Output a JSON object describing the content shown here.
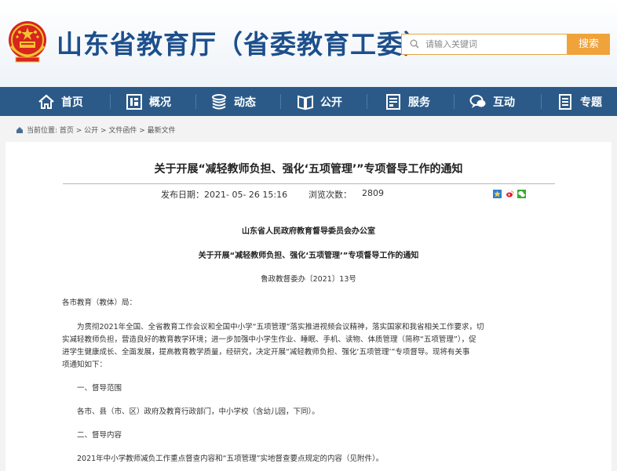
{
  "header": {
    "site_title": "山东省教育厅（省委教育工委）",
    "search_placeholder": "请输入关键词",
    "search_button": "搜索"
  },
  "nav": [
    {
      "label": "首页",
      "icon": "home-icon"
    },
    {
      "label": "概况",
      "icon": "overview-icon"
    },
    {
      "label": "动态",
      "icon": "news-stack-icon"
    },
    {
      "label": "公开",
      "icon": "book-icon"
    },
    {
      "label": "服务",
      "icon": "service-doc-icon"
    },
    {
      "label": "互动",
      "icon": "chat-icon"
    },
    {
      "label": "专题",
      "icon": "topic-doc-icon"
    }
  ],
  "breadcrumb": {
    "text": "当前位置: 首页 > 公开 > 文件函件 > 最新文件"
  },
  "article": {
    "title": "关于开展“减轻教师负担、强化‘五项管理’”专项督导工作的通知",
    "published_label": "发布日期：",
    "published_value": "2021- 05- 26 15:16",
    "views_label": "浏览次数：",
    "views_value": "2809",
    "issuer": "山东省人民政府教育督导委员会办公室",
    "inner_title": "关于开展“减轻教师负担、强化‘五项管理’”专项督导工作的通知",
    "doc_number": "鲁政教督委办〔2021〕13号",
    "salutation": "各市教育（教体）局：",
    "para1_line1": "为贯彻2021年全国、全省教育工作会议和全国中小学“五项管理”落实推进视频会议精神，落实国家和我省相关工作要求，切",
    "para1_line2": "实减轻教师负担，营造良好的教育教学环境；进一步加强中小学生作业、睡眠、手机、读物、体质管理（简称“五项管理”），促",
    "para1_line3": "进学生健康成长、全面发展，提高教育教学质量，经研究，决定开展“减轻教师负担、强化‘五项管理’”专项督导。现将有关事",
    "para1_line4": "项通知如下：",
    "section1_heading": "一、督导范围",
    "section1_body": "各市、县（市、区）政府及教育行政部门，中小学校（含幼儿园，下同）。",
    "section2_heading": "二、督导内容",
    "section2_body": "2021年中小学教师减负工作重点督查内容和“五项管理”实地督查要点规定的内容（见附件）。"
  },
  "colors": {
    "brand_blue": "#1d4f8c",
    "nav_bg": "#2b5a88",
    "search_orange": "#f0a33a"
  }
}
